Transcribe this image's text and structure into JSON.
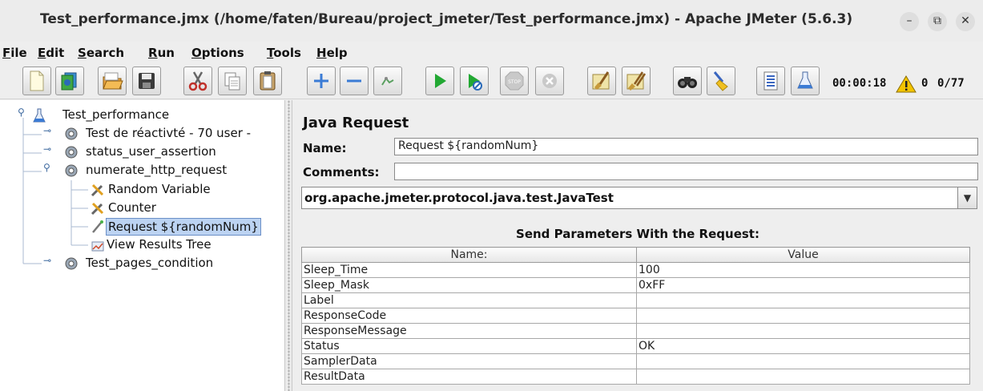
{
  "window": {
    "title": "Test_performance.jmx (/home/faten/Bureau/project_jmeter/Test_performance.jmx) - Apache JMeter (5.6.3)",
    "minimize": "–",
    "restore": "⧉",
    "close": "✕"
  },
  "menu": {
    "items": [
      {
        "label": "File",
        "mnemonic": "F",
        "rest": "ile"
      },
      {
        "label": "Edit",
        "mnemonic": "E",
        "rest": "dit"
      },
      {
        "label": "Search",
        "mnemonic": "S",
        "rest": "earch"
      },
      {
        "label": "Run",
        "mnemonic": "R",
        "rest": "un"
      },
      {
        "label": "Options",
        "mnemonic": "O",
        "rest": "ptions"
      },
      {
        "label": "Tools",
        "mnemonic": "T",
        "rest": "ools"
      },
      {
        "label": "Help",
        "mnemonic": "H",
        "rest": "elp"
      }
    ]
  },
  "toolbar": {
    "buttons": [
      "new-icon",
      "templates-icon",
      "open-icon",
      "save-icon",
      "cut-icon",
      "copy-icon",
      "paste-icon",
      "expand-icon",
      "collapse-icon",
      "toggle-icon",
      "start-icon",
      "start-no-pause-icon",
      "stop-icon",
      "shutdown-icon",
      "clear-icon",
      "clear-all-icon",
      "search-icon",
      "reset-search-icon",
      "function-helper-icon",
      "help-icon"
    ],
    "timer": "00:00:18",
    "error_count": "0",
    "threads": "0/77"
  },
  "tree": {
    "nodes": [
      {
        "label": "Test_performance",
        "toggle": "⚲",
        "icon": "test-plan-icon"
      },
      {
        "label": "Test de réactivté - 70 user -",
        "toggle": "⊸",
        "icon": "thread-group-icon"
      },
      {
        "label": "status_user_assertion",
        "toggle": "⊸",
        "icon": "thread-group-icon"
      },
      {
        "label": "numerate_http_request",
        "toggle": "⚲",
        "icon": "thread-group-icon"
      },
      {
        "label": "Random Variable",
        "icon": "config-element-icon"
      },
      {
        "label": "Counter",
        "icon": "config-element-icon"
      },
      {
        "label": "Request ${randomNum}",
        "icon": "sampler-icon",
        "selected": true
      },
      {
        "label": "View Results Tree",
        "icon": "listener-icon"
      },
      {
        "label": "Test_pages_condition",
        "toggle": "⊸",
        "icon": "thread-group-icon"
      }
    ]
  },
  "panel": {
    "title": "Java Request",
    "name_label": "Name:",
    "name_value": "Request ${randomNum}",
    "comments_label": "Comments:",
    "comments_value": "",
    "classname": "org.apache.jmeter.protocol.java.test.JavaTest",
    "dropdown_arrow": "▼",
    "params_title": "Send Parameters With the Request:",
    "table": {
      "headers": [
        "Name:",
        "Value"
      ],
      "rows": [
        [
          "Sleep_Time",
          "100"
        ],
        [
          "Sleep_Mask",
          "0xFF"
        ],
        [
          "Label",
          ""
        ],
        [
          "ResponseCode",
          ""
        ],
        [
          "ResponseMessage",
          ""
        ],
        [
          "Status",
          "OK"
        ],
        [
          "SamplerData",
          ""
        ],
        [
          "ResultData",
          ""
        ]
      ]
    }
  }
}
